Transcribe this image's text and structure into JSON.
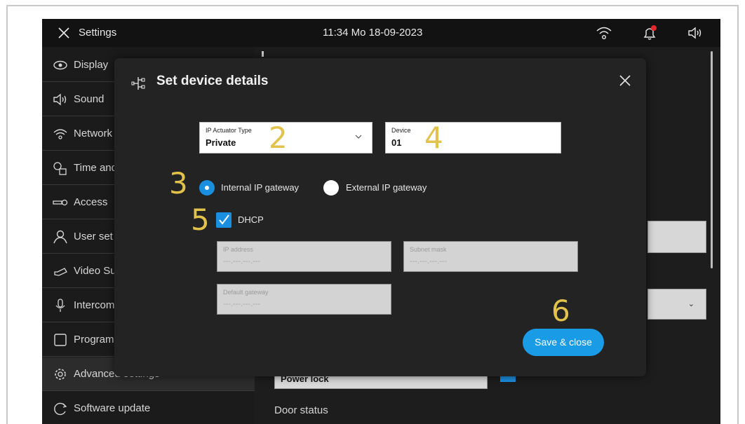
{
  "topbar": {
    "title": "Settings",
    "datetime": "11:34  Mo 18-09-2023",
    "icons": [
      "close-icon",
      "wifi-icon",
      "bell-icon",
      "speaker-icon"
    ],
    "notification_color": "#e5262b"
  },
  "sidebar": {
    "items": [
      {
        "label": "Display",
        "icon": "eye-icon"
      },
      {
        "label": "Sound",
        "icon": "speaker-icon"
      },
      {
        "label": "Network",
        "icon": "wifi-icon"
      },
      {
        "label": "Time and",
        "icon": "clock-calendar-icon"
      },
      {
        "label": "Access",
        "icon": "key-icon"
      },
      {
        "label": "User set",
        "icon": "user-icon"
      },
      {
        "label": "Video Su",
        "icon": "camera-icon"
      },
      {
        "label": "Intercom",
        "icon": "microphone-icon"
      },
      {
        "label": "Program",
        "icon": "square-icon"
      },
      {
        "label": "Advanced settings",
        "icon": "gear-icon",
        "active": true
      },
      {
        "label": "Software update",
        "icon": "refresh-icon"
      }
    ]
  },
  "background": {
    "power_field_value": "Power lock",
    "door_status_label": "Door status"
  },
  "dialog": {
    "title": "Set device details",
    "actuator_type": {
      "label": "IP Actuator Type",
      "value": "Private"
    },
    "device": {
      "label": "Device",
      "value": "01"
    },
    "gateway_options": [
      {
        "label": "Internal IP gateway",
        "selected": true
      },
      {
        "label": "External IP gateway",
        "selected": false
      }
    ],
    "dhcp": {
      "label": "DHCP",
      "checked": true
    },
    "ip_address": {
      "label": "IP address",
      "placeholder": "---.---.---.---"
    },
    "subnet_mask": {
      "label": "Subnet mask",
      "placeholder": "---.---.---.---"
    },
    "default_gateway": {
      "label": "Default gateway",
      "placeholder": "---.---.---.---"
    },
    "save_label": "Save & close",
    "accent_color": "#1a9be6"
  },
  "annotations": [
    "2",
    "4",
    "3",
    "5",
    "6"
  ]
}
